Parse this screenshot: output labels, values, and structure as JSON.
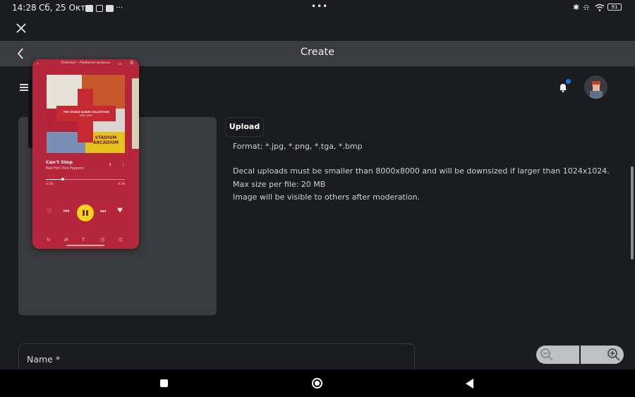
{
  "status_bar": {
    "time": "14:28",
    "date": "Сб, 25 Окт",
    "battery": "91",
    "more_dots": "•••"
  },
  "title_bar": {
    "title": "Create"
  },
  "upload": {
    "button_label": "Upload",
    "format": "Format: *.jpg, *.png, *.tga, *.bmp",
    "size_note": "Decal uploads must be smaller than 8000x8000 and will be downsized if larger than 1024x1024.",
    "max_size": "Max size per file: 20 MB",
    "moderation": "Image will be visible to others after moderation."
  },
  "form": {
    "name_label": "Name *"
  },
  "colors": {
    "background": "#1b1c1f",
    "titlebar": "#3b3c3f",
    "preview": "#3a3b3e",
    "notification_dot": "#1a73e8",
    "player_bg": "#b5263b",
    "play_button": "#f6d21e"
  },
  "music_player": {
    "header": "Плейлист «Любимая музыка»",
    "track_title": "Can't Stop",
    "artist": "Red Hot Chili Peppers",
    "album_text_1": "THE STUDIO ALBUM COLLECTION",
    "album_text_2": "1991-2011",
    "album_text_3": "STADIUM ARCADIUM",
    "elapsed": "0:56",
    "duration": "4:29",
    "progress": 0.21
  }
}
